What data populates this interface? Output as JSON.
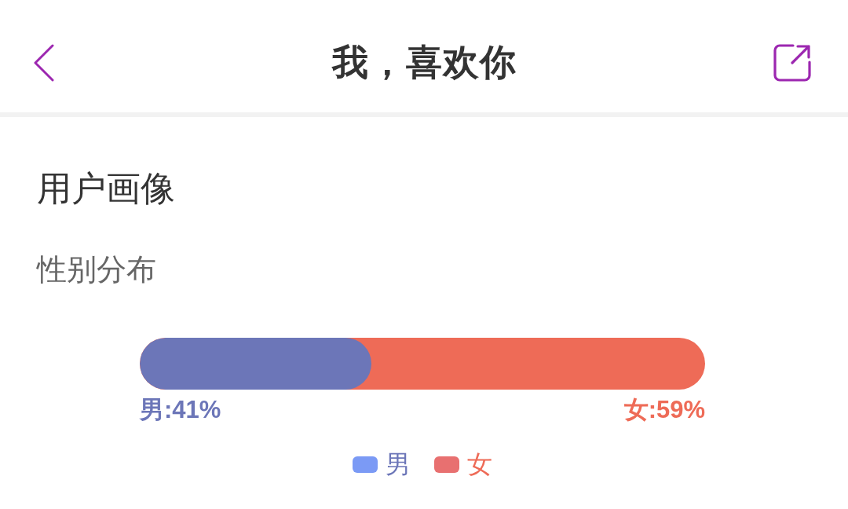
{
  "header": {
    "title": "我，喜欢你"
  },
  "section": {
    "title": "用户画像",
    "subtitle": "性别分布"
  },
  "gender_bar": {
    "level": 0.41
  },
  "share_labels": [
    {
      "text": "男:41%",
      "color": "#6c76b8"
    },
    {
      "text": "女:59%",
      "color": "#ee6b57"
    }
  ],
  "legend": [
    {
      "label": "男",
      "color": "#7b9af5"
    },
    {
      "label": "女",
      "color": "#e87070"
    }
  ]
}
